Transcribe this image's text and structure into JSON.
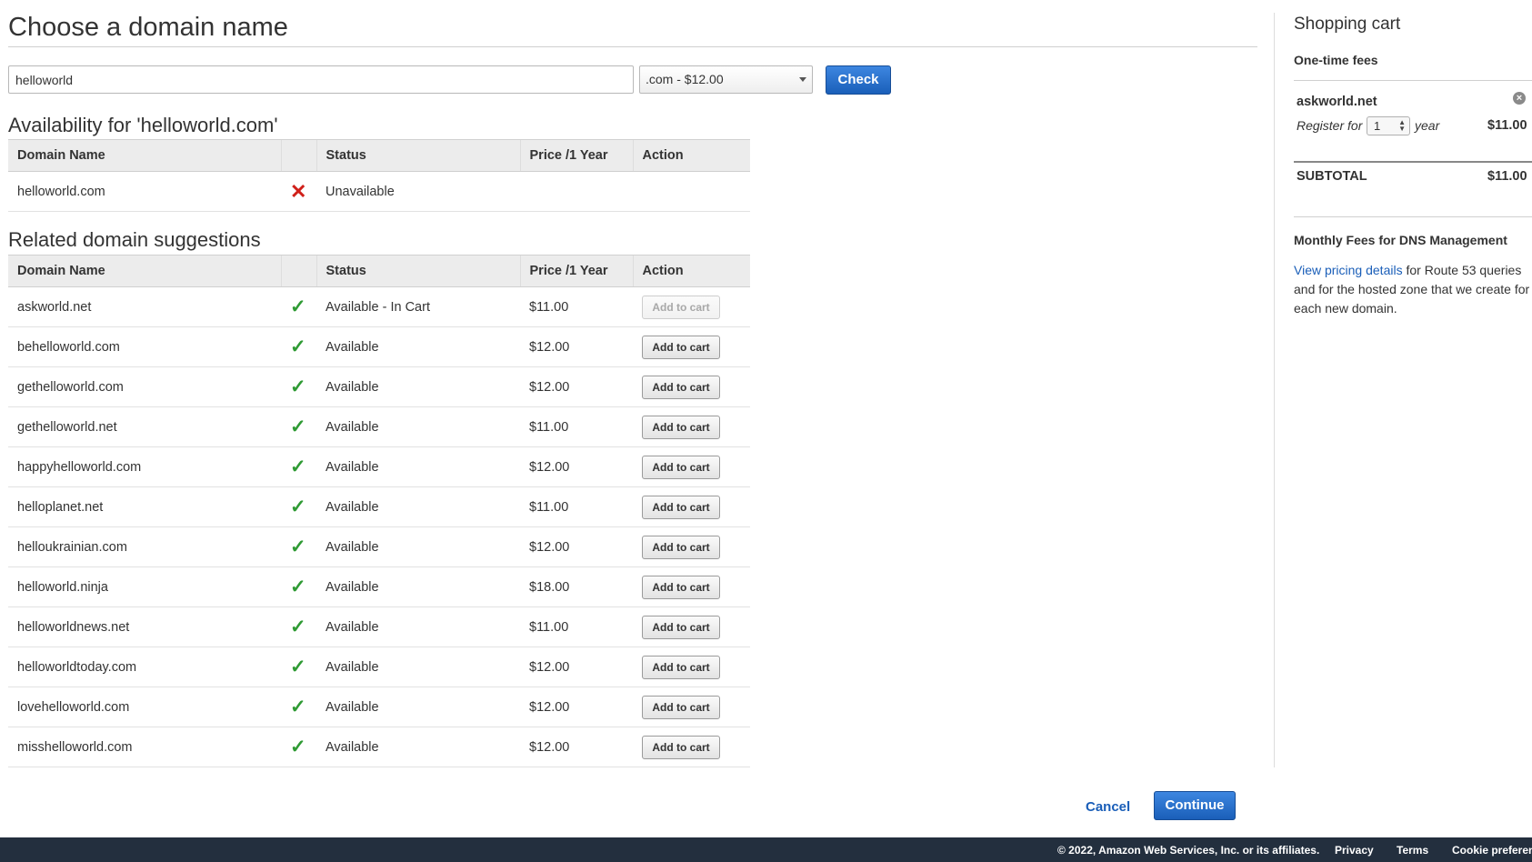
{
  "header": {
    "title": "Choose a domain name"
  },
  "search": {
    "value": "helloworld",
    "tld_selected": ".com - $12.00",
    "check_label": "Check"
  },
  "availability": {
    "title": "Availability for 'helloworld.com'",
    "columns": [
      "Domain Name",
      "",
      "Status",
      "Price /1 Year",
      "Action"
    ],
    "row": {
      "domain": "helloworld.com",
      "icon": "x-icon",
      "status": "Unavailable",
      "price": "",
      "action": ""
    }
  },
  "suggestions": {
    "title": "Related domain suggestions",
    "columns": [
      "Domain Name",
      "",
      "Status",
      "Price /1 Year",
      "Action"
    ],
    "rows": [
      {
        "domain": "askworld.net",
        "status": "Available - In Cart",
        "price": "$11.00",
        "action": "Add to cart",
        "disabled": true
      },
      {
        "domain": "behelloworld.com",
        "status": "Available",
        "price": "$12.00",
        "action": "Add to cart",
        "disabled": false
      },
      {
        "domain": "gethelloworld.com",
        "status": "Available",
        "price": "$12.00",
        "action": "Add to cart",
        "disabled": false
      },
      {
        "domain": "gethelloworld.net",
        "status": "Available",
        "price": "$11.00",
        "action": "Add to cart",
        "disabled": false
      },
      {
        "domain": "happyhelloworld.com",
        "status": "Available",
        "price": "$12.00",
        "action": "Add to cart",
        "disabled": false
      },
      {
        "domain": "helloplanet.net",
        "status": "Available",
        "price": "$11.00",
        "action": "Add to cart",
        "disabled": false
      },
      {
        "domain": "helloukrainian.com",
        "status": "Available",
        "price": "$12.00",
        "action": "Add to cart",
        "disabled": false
      },
      {
        "domain": "helloworld.ninja",
        "status": "Available",
        "price": "$18.00",
        "action": "Add to cart",
        "disabled": false
      },
      {
        "domain": "helloworldnews.net",
        "status": "Available",
        "price": "$11.00",
        "action": "Add to cart",
        "disabled": false
      },
      {
        "domain": "helloworldtoday.com",
        "status": "Available",
        "price": "$12.00",
        "action": "Add to cart",
        "disabled": false
      },
      {
        "domain": "lovehelloworld.com",
        "status": "Available",
        "price": "$12.00",
        "action": "Add to cart",
        "disabled": false
      },
      {
        "domain": "misshelloworld.com",
        "status": "Available",
        "price": "$12.00",
        "action": "Add to cart",
        "disabled": false
      }
    ]
  },
  "cart": {
    "title": "Shopping cart",
    "subtitle": "One-time fees",
    "item": {
      "name": "askworld.net",
      "register_label": "Register for",
      "years": "1",
      "year_label": "year",
      "price": "$11.00"
    },
    "subtotal_label": "SUBTOTAL",
    "subtotal_value": "$11.00",
    "monthly_title": "Monthly Fees for DNS Management",
    "pricing_link": "View pricing details",
    "monthly_text": " for Route 53 queries and for the hosted zone that we create for each new domain."
  },
  "actions": {
    "cancel": "Cancel",
    "continue": "Continue"
  },
  "footer": {
    "copyright": "© 2022, Amazon Web Services, Inc. or its affiliates.",
    "privacy": "Privacy",
    "terms": "Terms",
    "cookies": "Cookie preferences"
  },
  "colors": {
    "primary_blue": "#1a5fb9",
    "available_green": "#2e9a33",
    "unavailable_red": "#d0201a",
    "footer_bg": "#232f3e"
  }
}
